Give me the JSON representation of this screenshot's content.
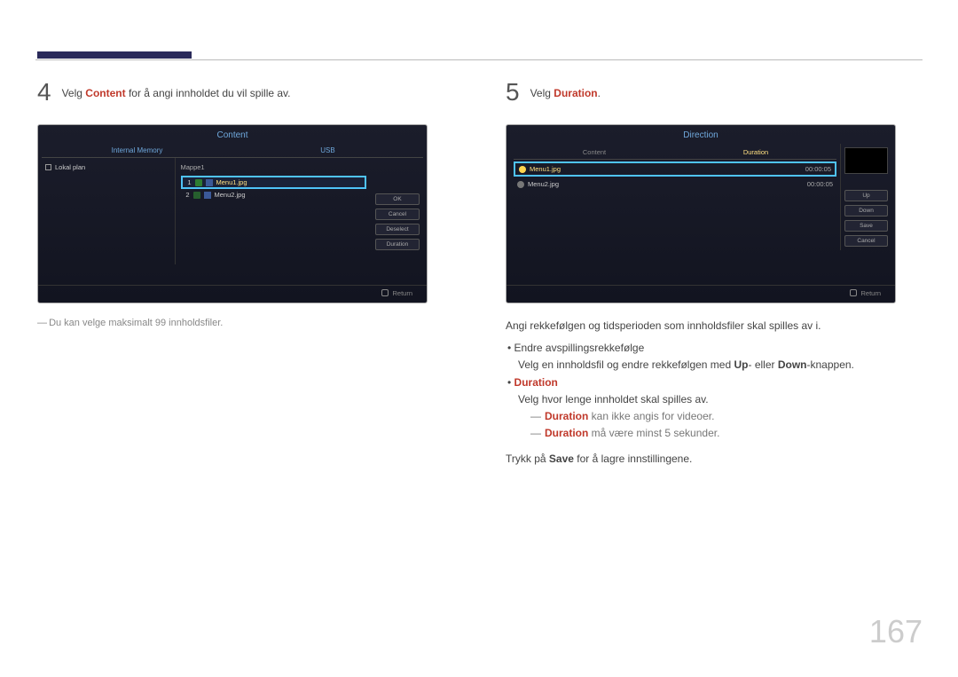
{
  "page_number": "167",
  "left": {
    "step": "4",
    "text_before": "Velg ",
    "text_highlight": "Content",
    "text_after": " for å angi innholdet du vil spille av.",
    "note_dash": "―",
    "note": "Du kan velge maksimalt 99 innholdsfiler.",
    "screen": {
      "title": "Content",
      "tab_left": "Internal Memory",
      "tab_right": "USB",
      "lokal_plan": "Lokal plan",
      "folder": "Mappe1",
      "files": [
        {
          "idx": "1",
          "name": "Menu1.jpg"
        },
        {
          "idx": "2",
          "name": "Menu2.jpg"
        }
      ],
      "buttons": [
        "OK",
        "Cancel",
        "Deselect",
        "Duration"
      ],
      "return": "Return"
    }
  },
  "right": {
    "step": "5",
    "text_before": "Velg ",
    "text_highlight": "Duration",
    "text_after": ".",
    "screen": {
      "title": "Direction",
      "tab_left": "Content",
      "tab_right": "Duration",
      "rows": [
        {
          "name": "Menu1.jpg",
          "dur": "00:00:05"
        },
        {
          "name": "Menu2.jpg",
          "dur": "00:00:05"
        }
      ],
      "buttons": [
        "Up",
        "Down",
        "Save",
        "Cancel"
      ],
      "return": "Return"
    },
    "desc_intro": "Angi rekkefølgen og tidsperioden som innholdsfiler skal spilles av i.",
    "bullet1_title": "Endre avspillingsrekkefølge",
    "bullet1_body_a": "Velg en innholdsfil og endre rekkefølgen med ",
    "bullet1_up": "Up",
    "bullet1_mid": "- eller ",
    "bullet1_down": "Down",
    "bullet1_body_b": "-knappen.",
    "bullet2_title": "Duration",
    "bullet2_body": "Velg hvor lenge innholdet skal spilles av.",
    "sub1_hl": "Duration",
    "sub1_rest": " kan ikke angis for videoer.",
    "sub2_hl": "Duration",
    "sub2_rest": " må være minst 5 sekunder.",
    "final_a": "Trykk på ",
    "final_hl": "Save",
    "final_b": " for å lagre innstillingene."
  }
}
